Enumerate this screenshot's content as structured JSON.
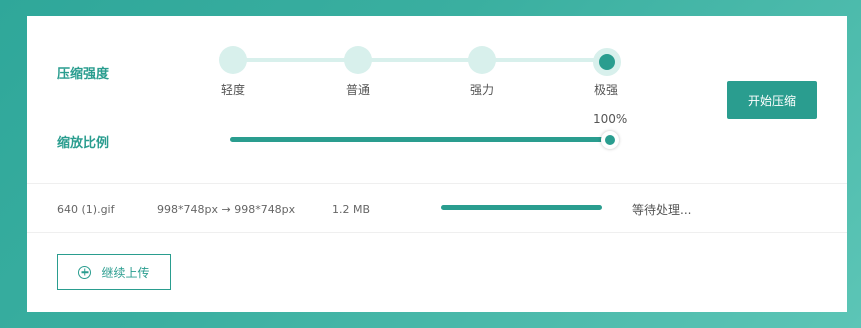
{
  "compression": {
    "label": "压缩强度",
    "levels": [
      "轻度",
      "普通",
      "强力",
      "极强"
    ],
    "selected": "极强"
  },
  "scale": {
    "label": "缩放比例",
    "value_text": "100%",
    "value": 1.0
  },
  "start_button": "开始压缩",
  "file": {
    "name": "640 (1).gif",
    "dimensions": "998*748px → 998*748px",
    "size": "1.2 MB",
    "progress": 1.0,
    "status": "等待处理..."
  },
  "upload_button": "继续上传",
  "colors": {
    "accent": "#2a9d8f",
    "track": "#d8f0ec"
  }
}
